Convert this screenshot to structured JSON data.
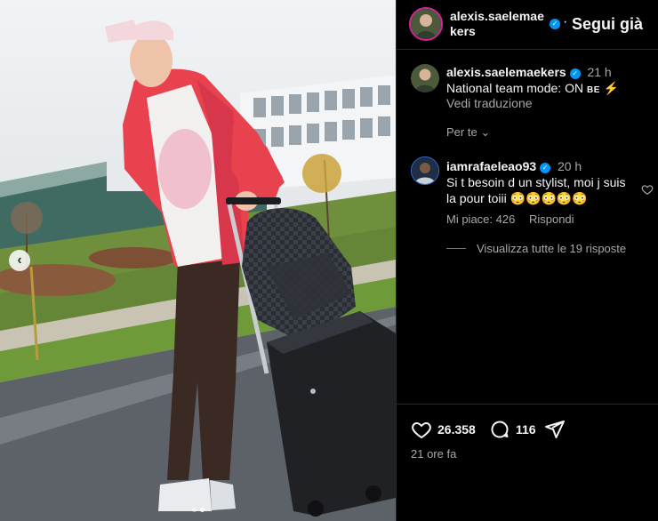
{
  "post": {
    "author": "alexis.saelemaekers",
    "follow_state": "Segui già",
    "separator": "·"
  },
  "caption": {
    "user": "alexis.saelemaekers",
    "time": "21 h",
    "text": "National team mode: ON",
    "suffix": "BE",
    "translate_link": "Vedi traduzione",
    "for_you": "Per te"
  },
  "comments": [
    {
      "user": "iamrafaeleao93",
      "time": "20 h",
      "text": "Si t besoin d un stylist, moi j suis la pour toiii 😳😳😳😳😳",
      "likes_label": "Mi piace: 426",
      "reply_label": "Rispondi"
    }
  ],
  "view_replies": "Visualizza tutte le 19 risposte",
  "stats": {
    "likes": "26.358",
    "comments": "116"
  },
  "posted_ago": "21 ore fa",
  "carousel": {
    "count": 2,
    "active_index": 1
  },
  "icons": {
    "like": "heart-icon",
    "comment": "comment-icon",
    "share": "send-icon",
    "verified": "verified-badge-icon",
    "prev": "chevron-left-icon",
    "chevron": "chevron-down-icon",
    "fire": "lightning-icon"
  },
  "colors": {
    "background": "#000000",
    "verified": "#0095f6",
    "muted_text": "#a8a8a8",
    "hoodie": "#e8424f"
  }
}
